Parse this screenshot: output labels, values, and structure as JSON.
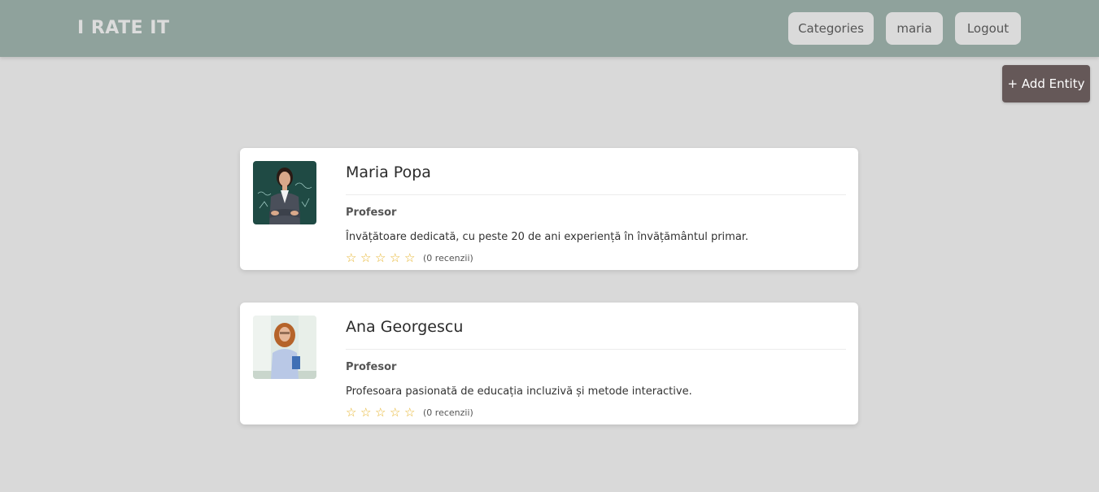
{
  "navbar": {
    "brand": "I RATE IT",
    "categories_label": "Categories",
    "user_label": "maria",
    "logout_label": "Logout"
  },
  "actions": {
    "add_entity_label": "+ Add Entity"
  },
  "entities": [
    {
      "name": "Maria Popa",
      "role": "Profesor",
      "description": "Învățătoare dedicată, cu peste 20 de ani experiență în învățământul primar.",
      "rating": 0,
      "reviews_label": "(0 recenzii)"
    },
    {
      "name": "Ana Georgescu",
      "role": "Profesor",
      "description": "Profesoara pasionată de educația incluzivă și metode interactive.",
      "rating": 0,
      "reviews_label": "(0 recenzii)"
    }
  ],
  "colors": {
    "navbar": "#8fa29c",
    "add_button": "#655858",
    "star": "#e6b32a",
    "background": "#d9d9d9"
  }
}
